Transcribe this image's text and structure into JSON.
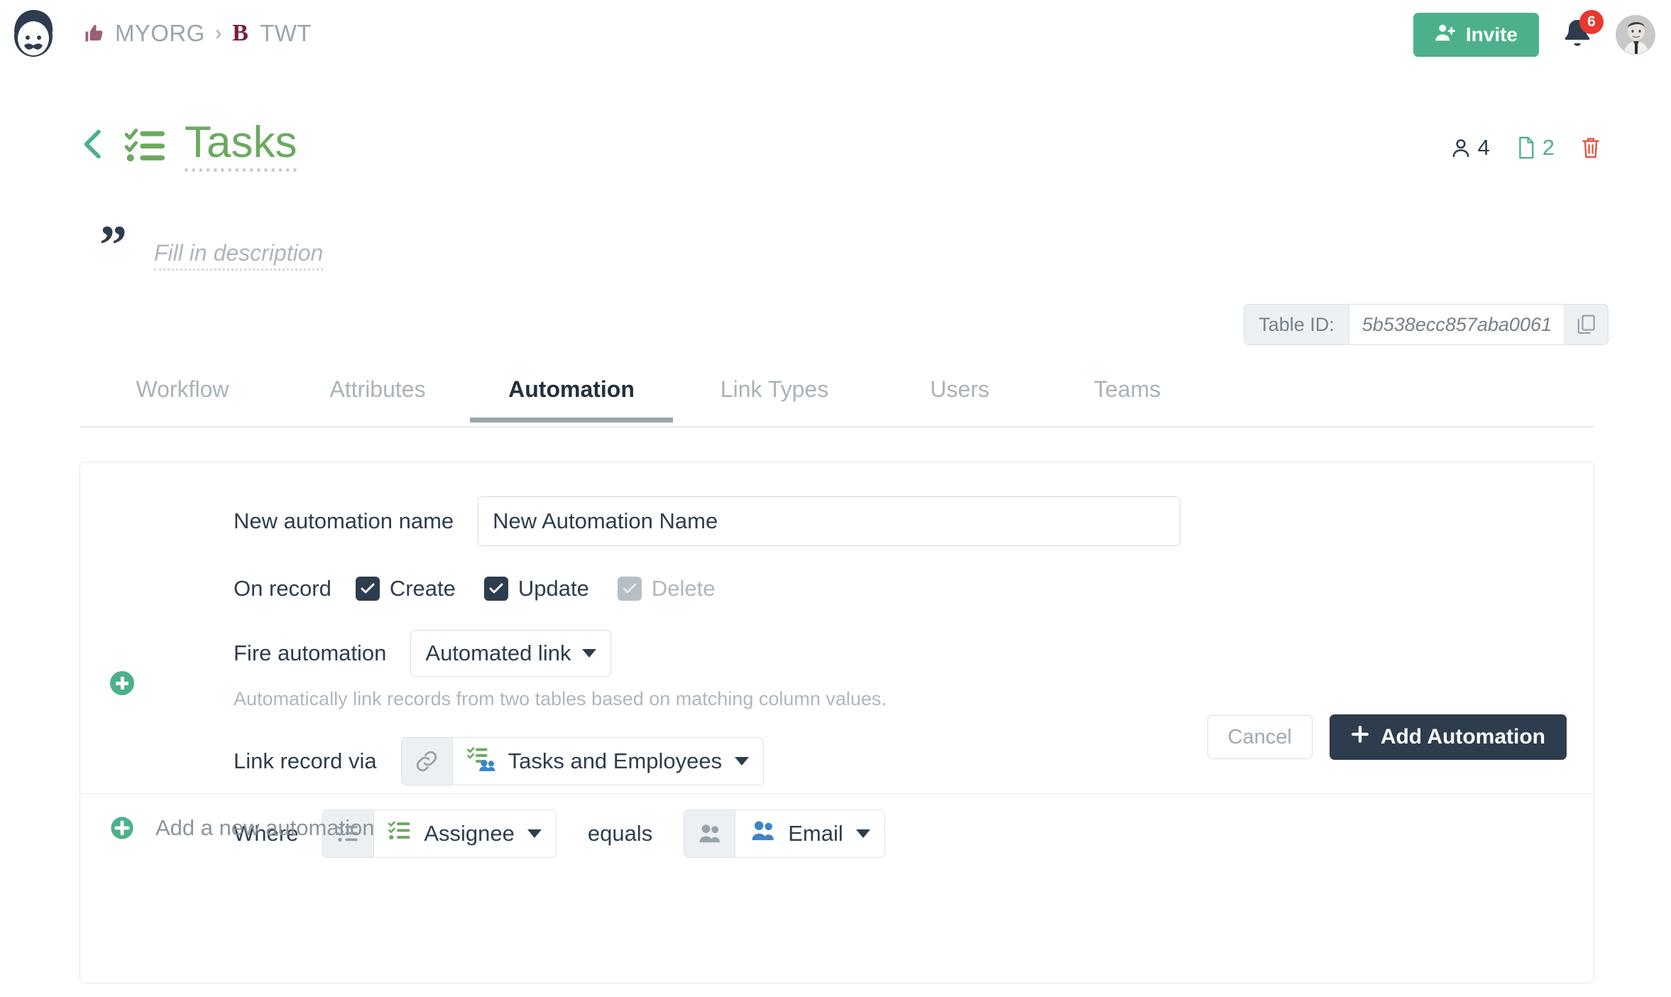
{
  "topbar": {
    "logo_icon": "mustache-face-logo",
    "breadcrumb": {
      "thumb_icon": "thumbs-up-icon",
      "org": "MYORG",
      "separator": "›",
      "board_badge": "B",
      "board": "TWT"
    },
    "invite_label": "Invite",
    "invite_icon": "user-plus-icon",
    "bell_icon": "bell-icon",
    "notification_count": "6",
    "avatar_icon": "user-avatar"
  },
  "title": {
    "back_icon": "chevron-left-icon",
    "table_icon": "checklist-icon",
    "text": "Tasks",
    "stats": {
      "users_icon": "user-icon",
      "users_count": "4",
      "docs_icon": "file-icon",
      "docs_count": "2",
      "delete_icon": "trash-icon"
    }
  },
  "description": {
    "quote_icon": "quote-icon",
    "placeholder": "Fill in description"
  },
  "table_id": {
    "label": "Table ID:",
    "value": "5b538ecc857aba0061",
    "copy_icon": "copy-icon"
  },
  "tabs": [
    {
      "label": "Workflow",
      "active": false
    },
    {
      "label": "Attributes",
      "active": false
    },
    {
      "label": "Automation",
      "active": true
    },
    {
      "label": "Link Types",
      "active": false
    },
    {
      "label": "Users",
      "active": false
    },
    {
      "label": "Teams",
      "active": false
    }
  ],
  "form": {
    "name_label": "New automation name",
    "name_value": "New Automation Name",
    "name_placeholder": "New Automation Name",
    "on_record_label": "On record",
    "checkboxes": [
      {
        "label": "Create",
        "checked": true,
        "disabled": false
      },
      {
        "label": "Update",
        "checked": true,
        "disabled": false
      },
      {
        "label": "Delete",
        "checked": true,
        "disabled": true
      }
    ],
    "fire_label": "Fire automation",
    "fire_value": "Automated link",
    "helper_text": "Automatically link records from two tables based on matching column values.",
    "add_step_icon": "plus-circle-icon",
    "link_label": "Link record via",
    "link_prefix_icon": "chain-link-icon",
    "link_value": "Tasks and Employees",
    "link_value_icon": "tasks-and-employees-icon",
    "where_label": "Where",
    "where_left_prefix_icon": "checklist-gray-icon",
    "where_left_value": "Assignee",
    "where_left_value_icon": "checklist-green-icon",
    "operator_label": "equals",
    "where_right_prefix_icon": "people-gray-icon",
    "where_right_value": "Email",
    "where_right_value_icon": "people-blue-icon"
  },
  "actions": {
    "cancel_label": "Cancel",
    "add_label": "Add Automation",
    "add_icon": "plus-icon"
  },
  "footer": {
    "add_icon": "plus-circle-icon",
    "add_label": "Add a new automation"
  },
  "colors": {
    "accent_green": "#4cb18a",
    "title_green": "#6aaa5f",
    "dark": "#2e3d4d",
    "muted": "#a9b3ba",
    "danger": "#e8392c",
    "board_badge": "#7a1d3f"
  }
}
